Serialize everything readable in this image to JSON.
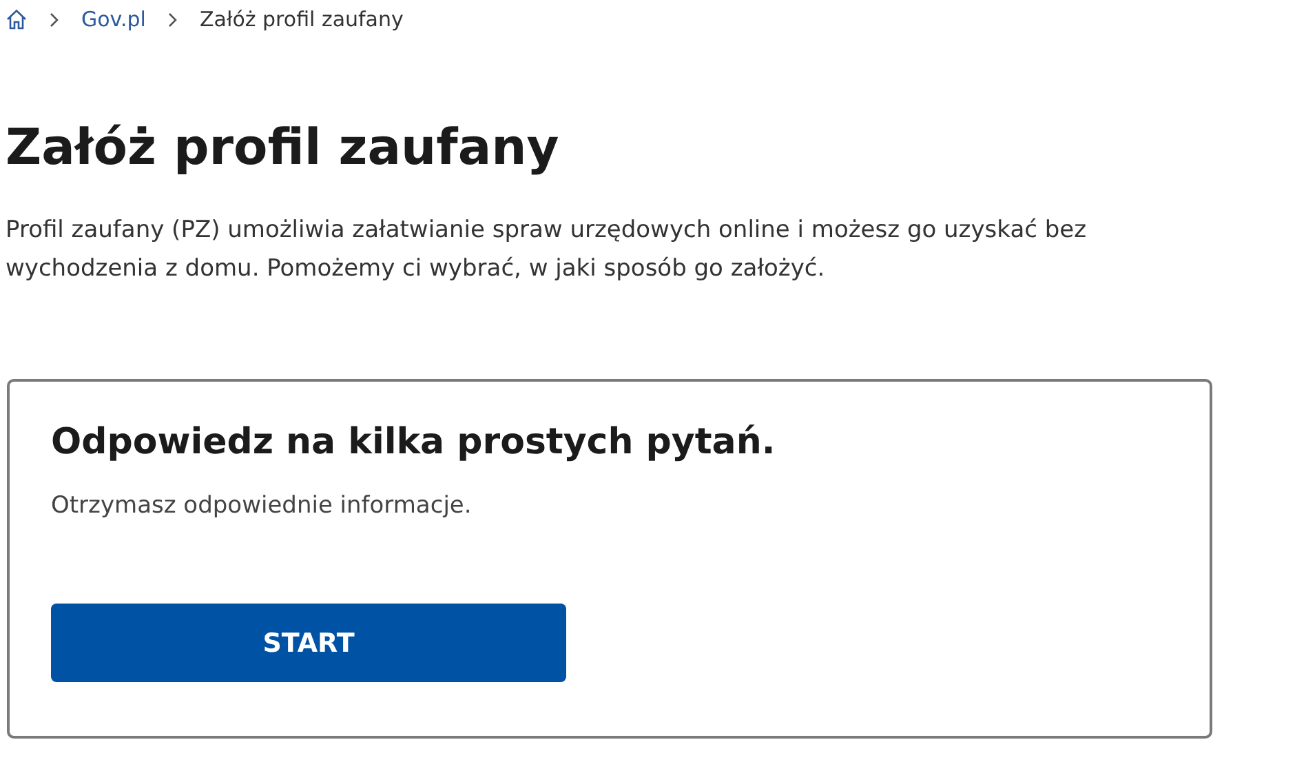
{
  "breadcrumb": [
    {
      "kind": "home"
    },
    {
      "kind": "link",
      "label": "Gov.pl"
    },
    {
      "kind": "current",
      "label": "Załóż profil zaufany"
    }
  ],
  "title": "Załóż profil zaufany",
  "intro": "Profil zaufany (PZ) umożliwia załatwianie spraw urzędowych online i możesz go uzyskać bez wychodzenia z domu. Pomożemy ci wybrać, w jaki sposób go założyć.",
  "card": {
    "heading": "Odpowiedz na kilka prostych pytań.",
    "text": "Otrzymasz odpowiednie informacje.",
    "button": "START"
  }
}
